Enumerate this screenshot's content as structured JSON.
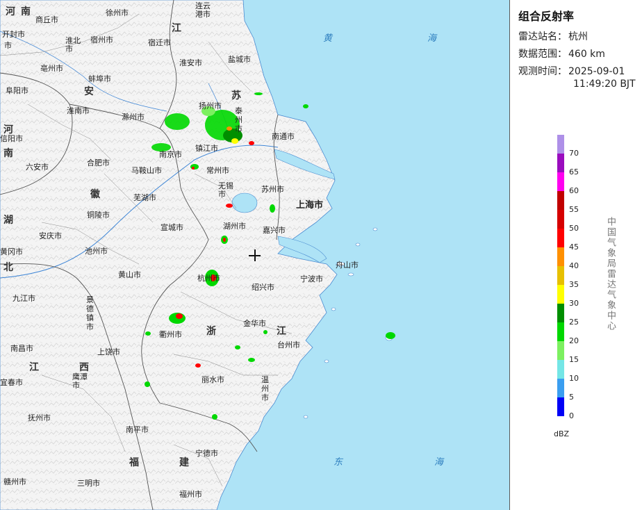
{
  "product": {
    "title": "组合反射率",
    "station_label": "雷达站名：",
    "station_value": "杭州",
    "range_label": "数据范围：",
    "range_value": "460 km",
    "time_label": "观测时间：",
    "time_date": "2025-09-01",
    "time_clock": "11:49:20 BJT"
  },
  "legend": {
    "unit": "dBZ",
    "organization": "中国气象局雷达气象中心",
    "levels": [
      {
        "value": "70",
        "color": "#ae90e8"
      },
      {
        "value": "65",
        "color": "#9a0cbe"
      },
      {
        "value": "60",
        "color": "#ff00f0"
      },
      {
        "value": "55",
        "color": "#c10000"
      },
      {
        "value": "50",
        "color": "#d60000"
      },
      {
        "value": "45",
        "color": "#ff0000"
      },
      {
        "value": "40",
        "color": "#ff9000"
      },
      {
        "value": "35",
        "color": "#e7c000"
      },
      {
        "value": "30",
        "color": "#ffff00"
      },
      {
        "value": "25",
        "color": "#008f00"
      },
      {
        "value": "20",
        "color": "#00d800"
      },
      {
        "value": "15",
        "color": "#7cf060"
      },
      {
        "value": "10",
        "color": "#74e6e6"
      },
      {
        "value": "5",
        "color": "#3a9ef0"
      },
      {
        "value": "0",
        "color": "#0000f6"
      }
    ]
  },
  "map": {
    "provinces": {
      "henan_1": "河",
      "henan_2": "南",
      "jiangsu_1": "江",
      "jiangsu_2": "苏",
      "anhui_1": "安",
      "anhui_2": "徽",
      "hubei_1": "湖",
      "hubei_2": "北",
      "henan_left_1": "河",
      "henan_left_2": "南",
      "zhejiang_1": "浙",
      "zhejiang_2": "江",
      "jiangxi_1": "江",
      "jiangxi_2": "西",
      "fujian_1": "福",
      "fujian_2": "建"
    },
    "seas": {
      "huang_1": "黄",
      "huang_2": "海",
      "dong_1": "东",
      "dong_2": "海"
    },
    "cities": {
      "shangqiu": "商丘市",
      "xuzhou": "徐州市",
      "lianyungang": "连云港市",
      "kaifeng": "开封市",
      "huaibei": "淮北市",
      "suzhou_ah": "宿州市",
      "suqian": "宿迁市",
      "bozhou": "亳州市",
      "bengbu": "蚌埠市",
      "huaian": "淮安市",
      "yancheng": "盐城市",
      "fuyang": "阜阳市",
      "huainan": "淮南市",
      "chuzhou": "滁州市",
      "yangzhou": "扬州市",
      "taizhou_js": "泰州市",
      "nantong": "南通市",
      "xinyang": "信阳市",
      "liuan": "六安市",
      "hefei": "合肥市",
      "nanjing": "南京市",
      "zhenjiang": "镇江市",
      "maanshan": "马鞍山市",
      "changzhou": "常州市",
      "wuxi": "无锡市",
      "suzhou_js": "苏州市",
      "shanghai": "上海市",
      "wuhu": "芜湖市",
      "tongling": "铜陵市",
      "xuancheng": "宣城市",
      "huzhou": "湖州市",
      "jiaxing": "嘉兴市",
      "anqing": "安庆市",
      "huanggang": "黄冈市",
      "chizhou": "池州市",
      "zhoushan": "舟山市",
      "huangshan": "黄山市",
      "hangzhou": "杭州市",
      "shaoxing": "绍兴市",
      "ningbo": "宁波市",
      "jiujiang": "九江市",
      "jingdezhen": "景德镇市",
      "jinhua": "金华市",
      "quzhou": "衢州市",
      "taizhou_zj": "台州市",
      "nanchang": "南昌市",
      "shangrao": "上饶市",
      "yingtan": "鹰潭市",
      "lishui": "丽水市",
      "wenzhou": "温州市",
      "yichun": "宜春市",
      "fuzhou_jx": "抚州市",
      "nanping": "南平市",
      "ningde": "宁德市",
      "ganzhou": "赣州市",
      "sanming": "三明市",
      "fuzhou_fj": "福州市",
      "shi": "市"
    }
  }
}
